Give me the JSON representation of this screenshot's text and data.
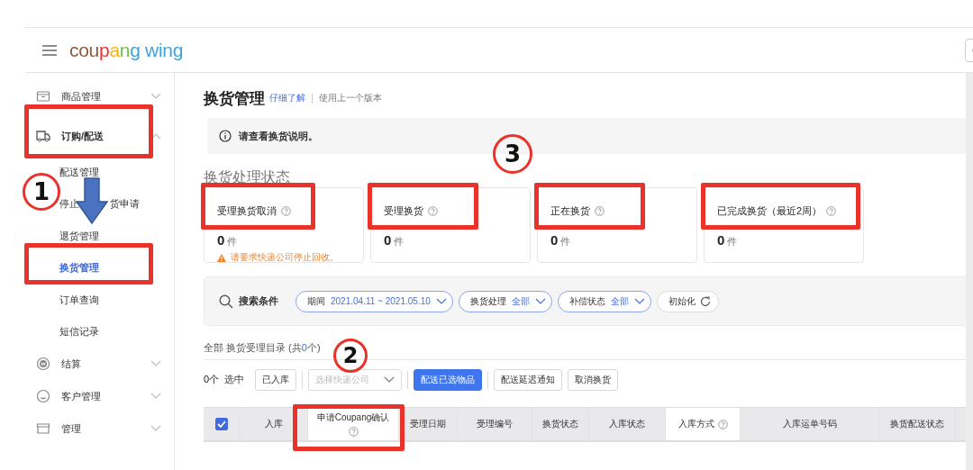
{
  "header": {
    "logo": "coupang wing"
  },
  "sidebar": {
    "items": [
      {
        "label": "商品管理",
        "expanded": false,
        "selected": false,
        "annotated": false
      },
      {
        "label": "订购/配送",
        "expanded": true,
        "selected": false,
        "annotated": true,
        "children": [
          {
            "label": "配送管理",
            "selected": false,
            "annotated": false
          },
          {
            "label": "停止",
            "label_after_arrow": "货申请",
            "selected": false,
            "annotated": false
          },
          {
            "label": "退货管理",
            "selected": false,
            "annotated": false
          },
          {
            "label": "换货管理",
            "selected": true,
            "annotated": true
          },
          {
            "label": "订单查询",
            "selected": false,
            "annotated": false
          },
          {
            "label": "短信记录",
            "selected": false,
            "annotated": false
          }
        ]
      },
      {
        "label": "结算",
        "expanded": false,
        "selected": false,
        "annotated": false
      },
      {
        "label": "客户管理",
        "expanded": false,
        "selected": false,
        "annotated": false
      },
      {
        "label": "管理",
        "expanded": false,
        "selected": false,
        "annotated": false
      }
    ]
  },
  "page": {
    "title": "换货管理",
    "links": [
      "仔细了解",
      "使用上一个版本"
    ],
    "notice": "请查看换货说明。"
  },
  "status": {
    "title": "换货处理状态",
    "cards": [
      {
        "label": "受理换货取消",
        "count": "0",
        "unit": "件",
        "warning": "请要求快递公司停止回收。",
        "annotated": true
      },
      {
        "label": "受理换货",
        "count": "0",
        "unit": "件",
        "annotated": true
      },
      {
        "label": "正在换货",
        "count": "0",
        "unit": "件",
        "annotated": true
      },
      {
        "label": "已完成换货（最近2周）",
        "count": "0",
        "unit": "件",
        "annotated": true
      }
    ]
  },
  "search": {
    "label": "搜索条件",
    "filters": [
      {
        "label": "期间",
        "value": "2021.04.11 ~ 2021.05.10"
      },
      {
        "label": "换货处理",
        "value": "全部"
      },
      {
        "label": "补偿状态",
        "value": "全部"
      }
    ],
    "reset": "初始化"
  },
  "list": {
    "title_start": "全部 换货受理目录 (共",
    "count": "0",
    "title_end": "个)"
  },
  "toolbar": {
    "selected_count": "0个",
    "selected_label": "选中",
    "items": [
      {
        "kind": "button",
        "label": "已入库"
      },
      {
        "kind": "divider"
      },
      {
        "kind": "select",
        "placeholder": "选择快递公司"
      },
      {
        "kind": "divider"
      },
      {
        "kind": "primary",
        "label": "配送已选物品"
      },
      {
        "kind": "divider"
      },
      {
        "kind": "button",
        "label": "配送延迟通知"
      },
      {
        "kind": "button",
        "label": "取消换货"
      }
    ]
  },
  "table": {
    "select_all": true,
    "columns": [
      {
        "label": "入库",
        "help": false,
        "shaded": false,
        "annotated": false
      },
      {
        "label": "申请Coupang确认",
        "help": true,
        "shaded": true,
        "annotated": true
      },
      {
        "label": "受理日期",
        "help": false,
        "shaded": false,
        "annotated": false
      },
      {
        "label": "受理编号",
        "help": false,
        "shaded": false,
        "annotated": false
      },
      {
        "label": "换货状态",
        "help": false,
        "shaded": false,
        "annotated": false
      },
      {
        "label": "入库状态",
        "help": false,
        "shaded": false,
        "annotated": false
      },
      {
        "label": "入库方式",
        "help": true,
        "shaded": true,
        "annotated": false
      },
      {
        "label": "入库运单号码",
        "help": false,
        "shaded": false,
        "annotated": false
      },
      {
        "label": "换货配送状态",
        "help": false,
        "shaded": false,
        "annotated": false
      }
    ]
  },
  "annotations": {
    "steps": [
      {
        "number": "1"
      },
      {
        "number": "2"
      },
      {
        "number": "3"
      }
    ],
    "arrow": true
  }
}
